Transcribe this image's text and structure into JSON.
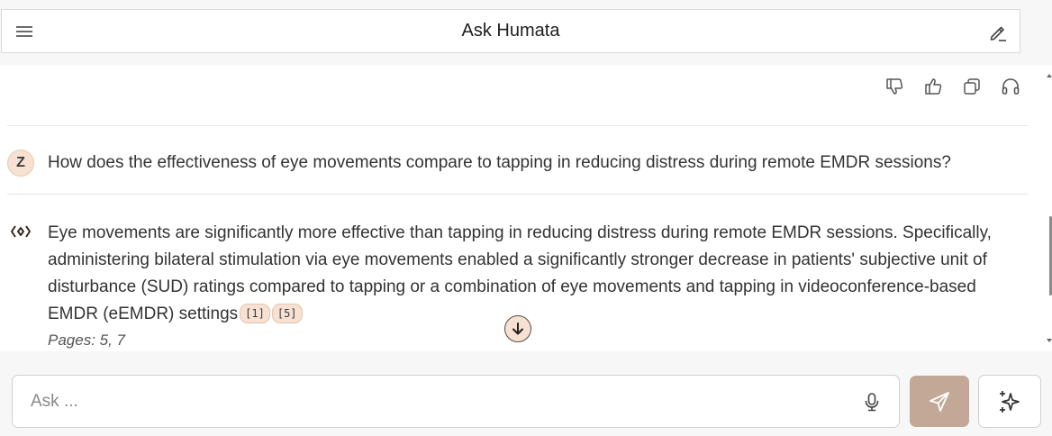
{
  "header": {
    "title": "Ask Humata"
  },
  "question": {
    "avatar_initial": "Z",
    "text": "How does the effectiveness of eye movements compare to tapping in reducing distress during remote EMDR sessions?"
  },
  "answer": {
    "text": "Eye movements are significantly more effective than tapping in reducing distress during remote EMDR sessions. Specifically, administering bilateral stimulation via eye movements enabled a significantly stronger decrease in patients' subjective unit of disturbance (SUD) ratings compared to tapping or a combination of eye movements and tapping in videoconference-based EMDR (eEMDR) settings",
    "citations": [
      "[1]",
      "[5]"
    ],
    "pages": "Pages: 5, 7"
  },
  "input": {
    "placeholder": "Ask ..."
  },
  "colors": {
    "accent": "#c3a898",
    "badge": "#f6e1d2"
  }
}
